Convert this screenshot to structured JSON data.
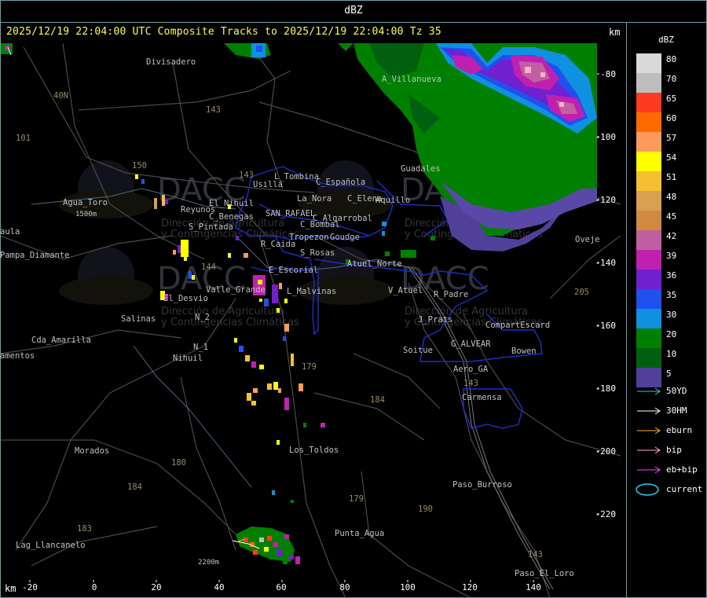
{
  "header": {
    "label": "dBZ"
  },
  "title": "2025/12/19 22:04:00 UTC Composite Tracks to 2025/12/19 22:04:00 Tz 35",
  "axis": {
    "unit_top": "km",
    "unit_bottom": "km",
    "x_ticks": [
      "-20",
      "0",
      "20",
      "40",
      "60",
      "80",
      "100",
      "120",
      "140"
    ],
    "y_ticks": [
      "-80",
      "-100",
      "-120",
      "-140",
      "-160",
      "-180",
      "-200",
      "-220"
    ]
  },
  "legend": {
    "title": "dBZ",
    "entries": [
      {
        "value": "80",
        "color": "#d9d9d9"
      },
      {
        "value": "70",
        "color": "#bdbdbd"
      },
      {
        "value": "65",
        "color": "#ff3a20"
      },
      {
        "value": "60",
        "color": "#ff6a00"
      },
      {
        "value": "57",
        "color": "#ff9a5a"
      },
      {
        "value": "54",
        "color": "#ffff00"
      },
      {
        "value": "51",
        "color": "#f5c030"
      },
      {
        "value": "48",
        "color": "#d8a050"
      },
      {
        "value": "45",
        "color": "#cf8a40"
      },
      {
        "value": "42",
        "color": "#c060a0"
      },
      {
        "value": "39",
        "color": "#c020b0"
      },
      {
        "value": "36",
        "color": "#7020d0"
      },
      {
        "value": "35",
        "color": "#2050f0"
      },
      {
        "value": "30",
        "color": "#1090e0"
      },
      {
        "value": "20",
        "color": "#008000"
      },
      {
        "value": "10",
        "color": "#006010"
      },
      {
        "value": "5",
        "color": "#50409a"
      }
    ],
    "tracks": [
      {
        "label": "50YD",
        "color": "#20d0f0"
      },
      {
        "label": "30HM",
        "color": "#ffffff"
      },
      {
        "label": "eburn",
        "color": "#ffb030"
      },
      {
        "label": "bip",
        "color": "#ffb0c0"
      },
      {
        "label": "eb+bip",
        "color": "#ff40ff"
      }
    ],
    "current_label": "current",
    "current_color": "#20d0f0"
  },
  "places": [
    "Divisadero",
    "A_Villanueva",
    "40N",
    "101",
    "Guadales",
    "L_Tombina",
    "Usilla",
    "C_Española",
    "La_Nora",
    "C_Elena",
    "Aquillo",
    "Agua_Toro",
    "1500m",
    "S_Pintada",
    "Reyunos",
    "El_Nihuil",
    "C_Benegas",
    "SAN_RAFAEL",
    "C_Algarrobal",
    "C_Bombal",
    "Tropezon",
    "Goudge",
    "aula",
    "Pampa_Diamante",
    "Cda_Amarilla",
    "amentos",
    "S_Rosas",
    "Atuel_Norte",
    "R_Caida",
    "E_Escorial",
    "Valle_Grande",
    "L_Malvinas",
    "El_Desvio",
    "Salinas",
    "N_2",
    "N_1",
    "Nihuil",
    "V_Atuel",
    "R_Padre",
    "J_Prats",
    "CompartEscard",
    "G_ALVEAR",
    "Soitue",
    "Bowen",
    "Aero_GA",
    "Carmensa",
    "Los_Toldos",
    "Morados",
    "Paso_Burroso",
    "Punta_Agua",
    "Lag_Llancanelo",
    "2200m",
    "Paso_El_Loro",
    "Oveje",
    "205",
    "143",
    "143",
    "184",
    "179",
    "190",
    "143",
    "180",
    "184",
    "183",
    "143",
    "144",
    "150",
    "179"
  ],
  "watermark": "DACC",
  "watermark_sub": [
    "Dirección de Agricultura",
    "y Contingencias Climáticas"
  ]
}
